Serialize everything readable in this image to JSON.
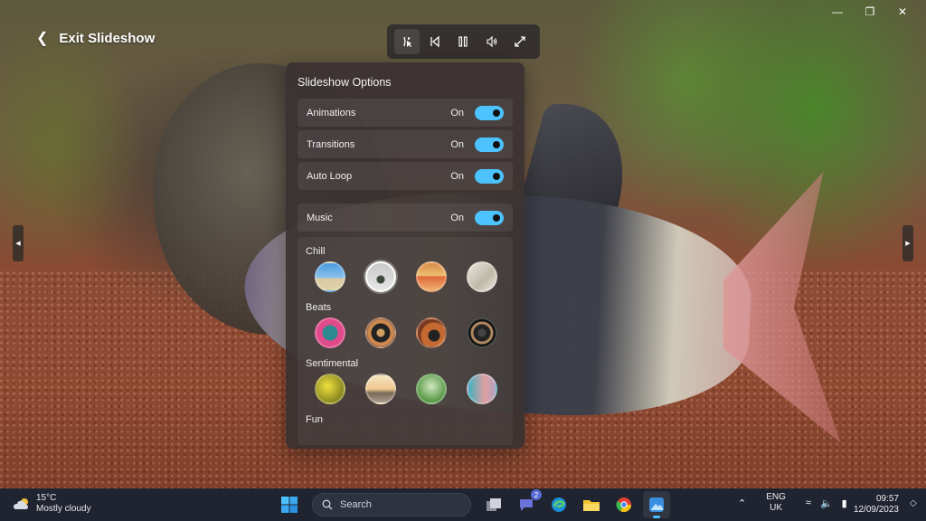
{
  "header": {
    "exit_label": "Exit Slideshow"
  },
  "panel": {
    "title": "Slideshow Options",
    "rows": [
      {
        "label": "Animations",
        "state": "On"
      },
      {
        "label": "Transitions",
        "state": "On"
      },
      {
        "label": "Auto Loop",
        "state": "On"
      },
      {
        "label": "Music",
        "state": "On"
      }
    ],
    "categories": [
      "Chill",
      "Beats",
      "Sentimental",
      "Fun"
    ]
  },
  "taskbar": {
    "weather_temp": "15°C",
    "weather_desc": "Mostly cloudy",
    "search_placeholder": "Search",
    "chat_badge": "2",
    "lang_top": "ENG",
    "lang_bottom": "UK",
    "time": "09:57",
    "date": "12/09/2023"
  },
  "colors": {
    "accent": "#4cc2ff",
    "panel_bg": "#3a3232",
    "taskbar_bg": "#1f2430"
  }
}
